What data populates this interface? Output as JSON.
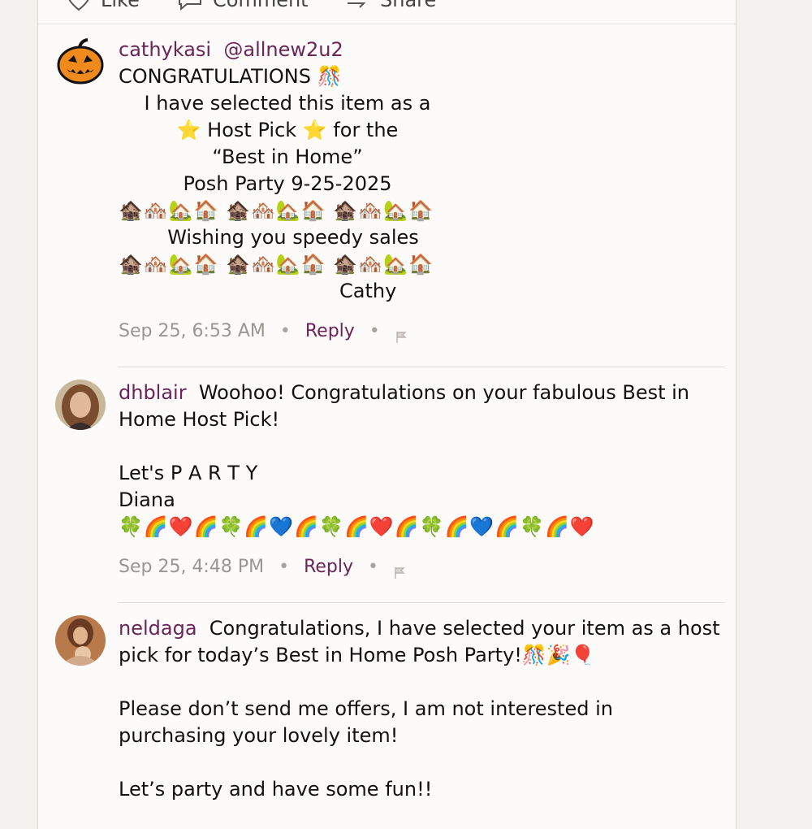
{
  "actions": {
    "like_label": "Like",
    "comment_label": "Comment",
    "share_label": "Share"
  },
  "comments": [
    {
      "username": "cathykasi",
      "mention": "@allnew2u2",
      "lines": [
        "CONGRATULATIONS 🎊",
        "I have selected this item as a",
        "⭐ Host Pick ⭐ for the",
        "“Best in Home”",
        "Posh Party 9-25-2025",
        "🏚️🏘️🏡🏠 🏚️🏘️🏡🏠 🏚️🏘️🏡🏠",
        "Wishing you speedy sales",
        "🏚️🏘️🏡🏠 🏚️🏘️🏡🏠 🏚️🏘️🏡🏠",
        "Cathy"
      ],
      "timestamp": "Sep 25, 6:53 AM",
      "reply_label": "Reply",
      "avatar_icon": "pumpkin-avatar"
    },
    {
      "username": "dhblair",
      "text_first": "Woohoo! Congratulations on your fabulous Best in",
      "lines": [
        "Home Host Pick!",
        "",
        "Let's P A R T Y",
        "Diana",
        "🍀🌈❤️🌈🍀🌈💙🌈🍀🌈❤️🌈🍀🌈💙🌈🍀🌈❤️"
      ],
      "timestamp": "Sep 25, 4:48 PM",
      "reply_label": "Reply",
      "avatar_icon": "user-photo-avatar"
    },
    {
      "username": "neldaga",
      "text_first": "Congratulations, I have selected your item as a host",
      "lines": [
        "pick for today’s Best in Home Posh Party!🎊🎉🎈",
        "",
        "Please don’t send me offers, I am not interested in",
        "purchasing your lovely item!",
        "",
        "Let’s party and have some fun!!"
      ],
      "avatar_icon": "user-photo-avatar"
    }
  ],
  "colors": {
    "username": "#6b2458",
    "meta": "#9a9590",
    "card_bg": "#fcfbfa",
    "page_bg": "#f4f2ef"
  }
}
